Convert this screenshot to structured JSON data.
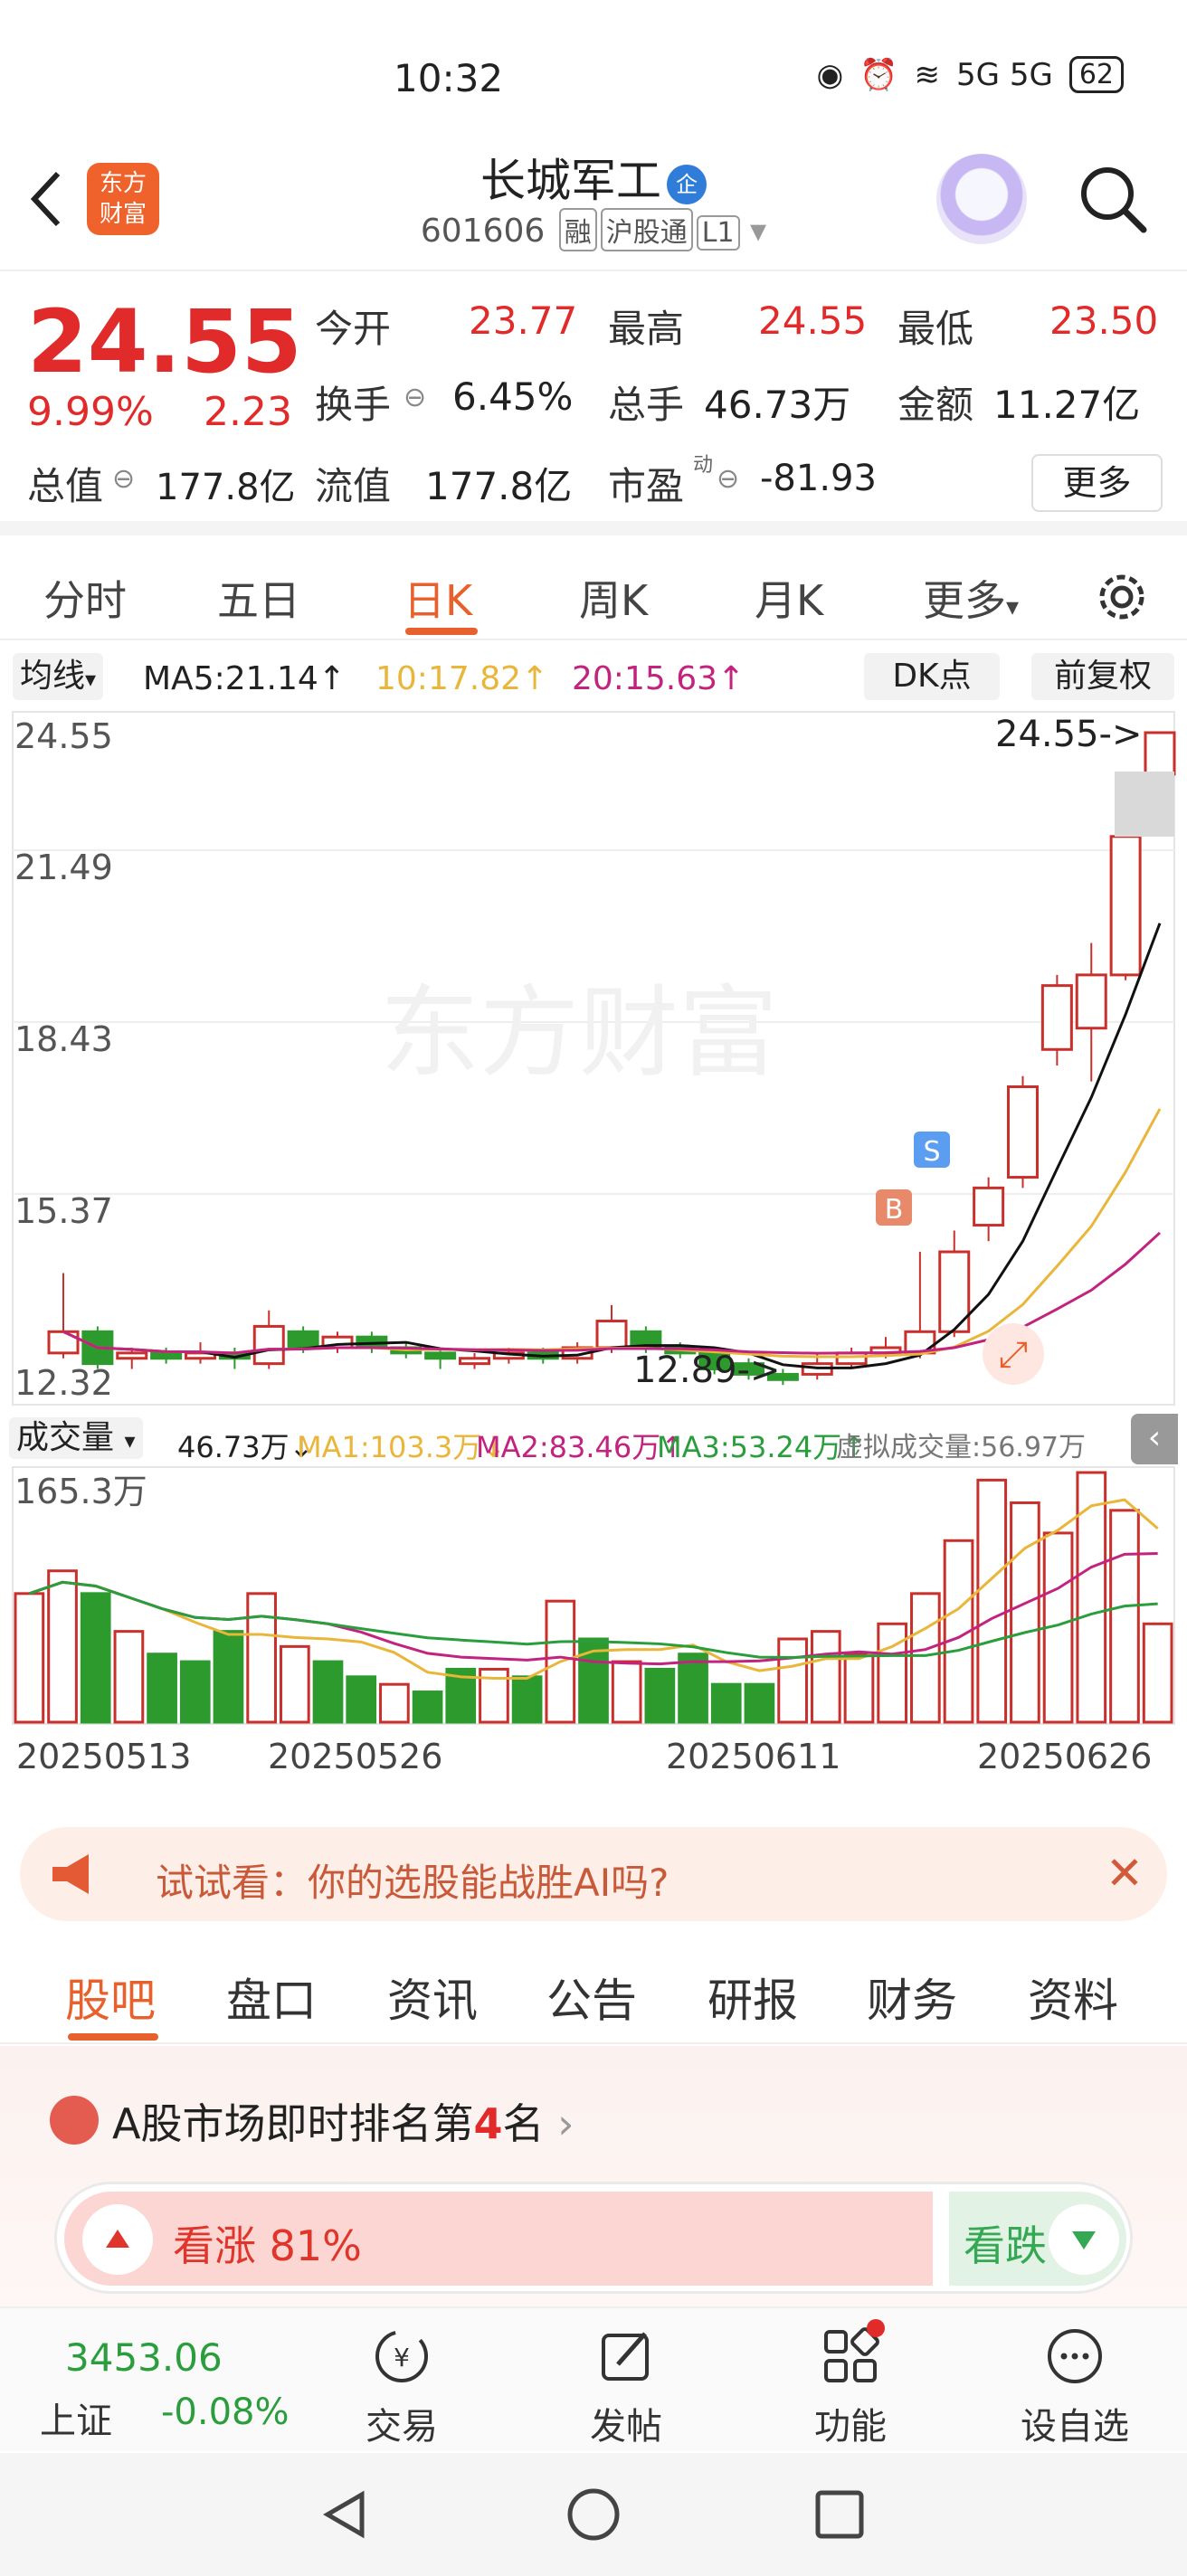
{
  "status_bar": {
    "time": "10:32",
    "network": "5G 5G",
    "battery": "62"
  },
  "header": {
    "logo_line1": "东方",
    "logo_line2": "财富",
    "title": "长城军工",
    "title_badge": "企",
    "code": "601606",
    "tags": [
      "融",
      "沪股通",
      "L1"
    ]
  },
  "quote": {
    "price": "24.55",
    "pct": "9.99%",
    "chg": "2.23",
    "open_label": "今开",
    "open": "23.77",
    "high_label": "最高",
    "high": "24.55",
    "low_label": "最低",
    "low": "23.50",
    "turnover_label": "换手",
    "turnover": "6.45%",
    "volume_label": "总手",
    "volume": "46.73万",
    "amount_label": "金额",
    "amount": "11.27亿",
    "mcap_label": "总值",
    "mcap": "177.8亿",
    "float_label": "流值",
    "float": "177.8亿",
    "pe_label": "市盈",
    "pe_sup": "动",
    "pe": "-81.93",
    "more": "更多"
  },
  "kline_tabs": [
    "分时",
    "五日",
    "日K",
    "周K",
    "月K",
    "更多"
  ],
  "ma": {
    "select": "均线",
    "ma5": "MA5:21.14↑",
    "ma10": "10:17.82↑",
    "ma20": "20:15.63↑",
    "dk": "DK点",
    "fq": "前复权"
  },
  "chart_data": {
    "type": "candlestick",
    "y_ticks": [
      "24.55",
      "21.49",
      "18.43",
      "15.37",
      "12.32"
    ],
    "ylim": [
      12.32,
      24.55
    ],
    "max_label": "24.55->",
    "min_label": "12.89->",
    "signal_b": "B",
    "signal_s": "S",
    "watermark": "东方财富",
    "candles": [
      {
        "o": 12.9,
        "c": 13.3,
        "h": 14.4,
        "l": 12.8
      },
      {
        "o": 13.3,
        "c": 12.7,
        "h": 13.4,
        "l": 12.6
      },
      {
        "o": 12.8,
        "c": 12.9,
        "h": 13.0,
        "l": 12.6
      },
      {
        "o": 12.9,
        "c": 12.8,
        "h": 13.0,
        "l": 12.7
      },
      {
        "o": 12.8,
        "c": 12.9,
        "h": 13.1,
        "l": 12.7
      },
      {
        "o": 12.9,
        "c": 12.8,
        "h": 13.0,
        "l": 12.6
      },
      {
        "o": 12.7,
        "c": 13.4,
        "h": 13.7,
        "l": 12.6
      },
      {
        "o": 13.3,
        "c": 13.0,
        "h": 13.4,
        "l": 12.9
      },
      {
        "o": 13.0,
        "c": 13.2,
        "h": 13.3,
        "l": 12.9
      },
      {
        "o": 13.2,
        "c": 13.0,
        "h": 13.3,
        "l": 12.9
      },
      {
        "o": 13.0,
        "c": 12.9,
        "h": 13.1,
        "l": 12.8
      },
      {
        "o": 12.9,
        "c": 12.8,
        "h": 13.0,
        "l": 12.6
      },
      {
        "o": 12.7,
        "c": 12.8,
        "h": 12.9,
        "l": 12.6
      },
      {
        "o": 12.8,
        "c": 12.9,
        "h": 13.0,
        "l": 12.7
      },
      {
        "o": 12.9,
        "c": 12.8,
        "h": 13.0,
        "l": 12.7
      },
      {
        "o": 12.8,
        "c": 13.0,
        "h": 13.1,
        "l": 12.7
      },
      {
        "o": 13.0,
        "c": 13.5,
        "h": 13.8,
        "l": 12.9
      },
      {
        "o": 13.3,
        "c": 13.0,
        "h": 13.4,
        "l": 12.9
      },
      {
        "o": 13.0,
        "c": 12.9,
        "h": 13.1,
        "l": 12.8
      },
      {
        "o": 12.9,
        "c": 12.6,
        "h": 13.0,
        "l": 12.5
      },
      {
        "o": 12.7,
        "c": 12.5,
        "h": 12.8,
        "l": 12.4
      },
      {
        "o": 12.5,
        "c": 12.4,
        "h": 12.6,
        "l": 12.3
      },
      {
        "o": 12.5,
        "c": 12.7,
        "h": 12.9,
        "l": 12.4
      },
      {
        "o": 12.7,
        "c": 12.9,
        "h": 13.0,
        "l": 12.6
      },
      {
        "o": 12.9,
        "c": 13.0,
        "h": 13.2,
        "l": 12.8
      },
      {
        "o": 12.9,
        "c": 13.3,
        "h": 14.8,
        "l": 12.8
      },
      {
        "o": 13.3,
        "c": 14.8,
        "h": 15.2,
        "l": 13.2
      },
      {
        "o": 15.3,
        "c": 16.0,
        "h": 16.2,
        "l": 15.0
      },
      {
        "o": 16.2,
        "c": 17.9,
        "h": 18.1,
        "l": 16.0
      },
      {
        "o": 18.6,
        "c": 19.8,
        "h": 20.0,
        "l": 18.3
      },
      {
        "o": 19.0,
        "c": 20.0,
        "h": 20.6,
        "l": 18.0
      },
      {
        "o": 20.0,
        "c": 22.6,
        "h": 23.0,
        "l": 19.9
      },
      {
        "o": 23.77,
        "c": 24.55,
        "h": 24.55,
        "l": 23.5
      }
    ]
  },
  "volume": {
    "label": "成交量",
    "vol": "46.73万↓",
    "ma1": "MA1:103.3万↓",
    "ma2": "MA2:83.46万↑",
    "ma3": "MA3:53.24万↑",
    "virtual": "虚拟成交量:56.97万",
    "max_tick": "165.3万",
    "bars": [
      85,
      100,
      85,
      60,
      45,
      40,
      60,
      85,
      50,
      40,
      30,
      25,
      20,
      35,
      35,
      30,
      80,
      55,
      40,
      35,
      45,
      25,
      25,
      55,
      60,
      45,
      65,
      85,
      120,
      160,
      145,
      125,
      165,
      140,
      65
    ],
    "bar_up": [
      1,
      1,
      0,
      1,
      0,
      0,
      0,
      1,
      1,
      0,
      0,
      1,
      0,
      0,
      1,
      0,
      1,
      0,
      1,
      0,
      0,
      0,
      0,
      1,
      1,
      1,
      1,
      1,
      1,
      1,
      1,
      1,
      1,
      1,
      1
    ]
  },
  "dates": [
    "20250513",
    "20250526",
    "20250611",
    "20250626"
  ],
  "banner": {
    "text": "试试看：你的选股能战胜AI吗?"
  },
  "sub_tabs": [
    "股吧",
    "盘口",
    "资讯",
    "公告",
    "研报",
    "财务",
    "资料"
  ],
  "rank": {
    "prefix": "A股市场即时排名第",
    "num": "4",
    "suffix": "名"
  },
  "vote": {
    "up": "看涨 81%",
    "down": "看跌"
  },
  "bottom_nav": {
    "index_value": "3453.06",
    "index_name": "上证",
    "index_change": "-0.08%",
    "items": [
      "交易",
      "发帖",
      "功能",
      "设自选"
    ]
  }
}
